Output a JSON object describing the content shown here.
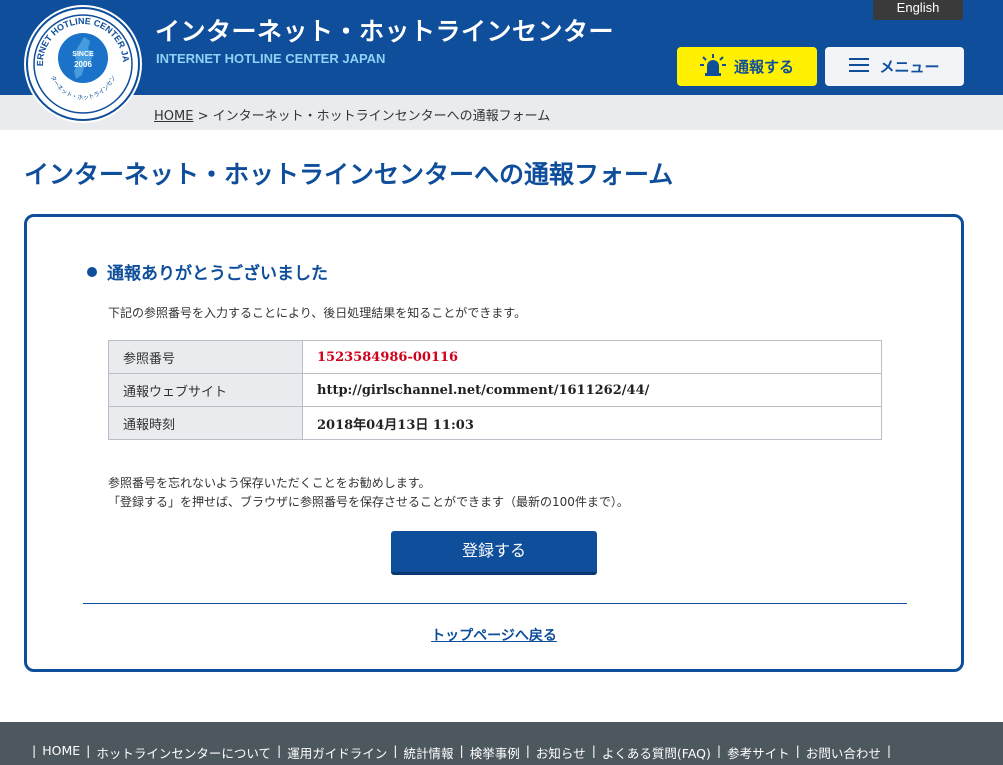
{
  "header": {
    "title": "インターネット・ホットラインセンター",
    "subtitle": "INTERNET HOTLINE CENTER JAPAN",
    "english_label": "English",
    "report_label": "通報する",
    "menu_label": "メニュー",
    "logo": {
      "ring_text": "INTERNET HOTLINE CENTER JAPAN",
      "since": "SINCE",
      "year": "2006",
      "bottom_text": "インターネット・ホットラインセンター"
    }
  },
  "breadcrumb": {
    "home": "HOME",
    "separator": ">",
    "current": "インターネット・ホットラインセンターへの通報フォーム"
  },
  "page_title": "インターネット・ホットラインセンターへの通報フォーム",
  "panel": {
    "heading": "通報ありがとうございました",
    "intro": "下記の参照番号を入力することにより、後日処理結果を知ることができます。",
    "rows": [
      {
        "label": "参照番号",
        "value": "1523584986-00116"
      },
      {
        "label": "通報ウェブサイト",
        "value": "http://girlschannel.net/comment/1611262/44/"
      },
      {
        "label": "通報時刻",
        "value": "2018年04月13日 11:03"
      }
    ],
    "note_line1": "参照番号を忘れないよう保存いただくことをお勧めします。",
    "note_line2": "「登録する」を押せば、ブラウザに参照番号を保存させることができます（最新の100件まで）。",
    "register_label": "登録する",
    "back_link": "トップページへ戻る"
  },
  "footer": {
    "links": [
      "HOME",
      "ホットラインセンターについて",
      "運用ガイドライン",
      "統計情報",
      "検挙事例",
      "お知らせ",
      "よくある質問(FAQ)",
      "参考サイト",
      "お問い合わせ"
    ],
    "separator": "|"
  },
  "colors": {
    "brand_blue": "#0e4e9b",
    "accent_yellow": "#fff100",
    "reference_red": "#d0021b",
    "footer_gray": "#4c575e"
  }
}
